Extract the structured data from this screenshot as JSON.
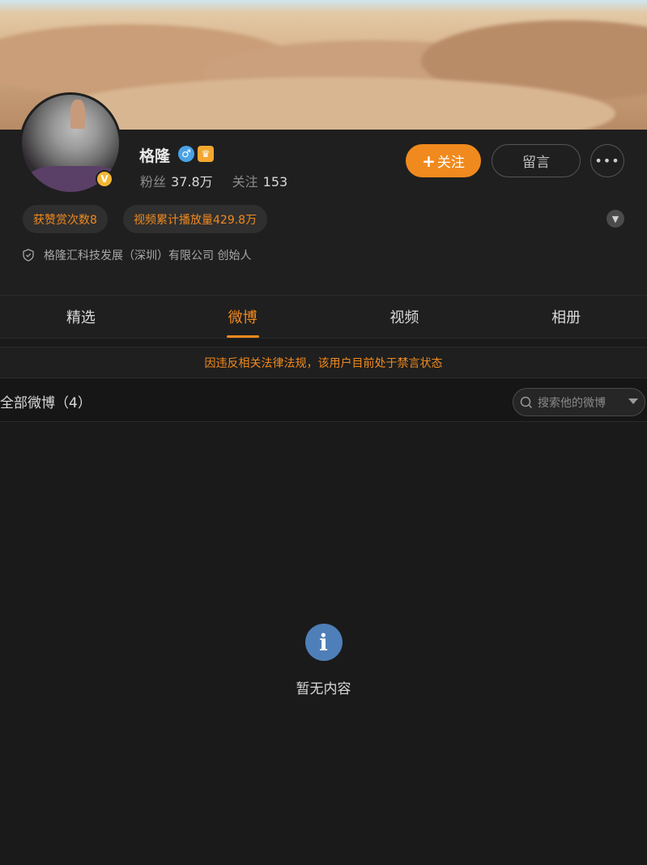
{
  "profile": {
    "name": "格隆",
    "verified_badge": "V",
    "gender_symbol": "♂",
    "fans_label": "粉丝",
    "fans_value": "37.8万",
    "following_label": "关注",
    "following_value": "153",
    "follow_button": "关注",
    "follow_plus": "+",
    "message_button": "留言",
    "more_button": "•••",
    "tags": [
      "获赞赏次数8",
      "视频累计播放量429.8万"
    ],
    "company": "格隆汇科技发展（深圳）有限公司 创始人"
  },
  "tabs": [
    {
      "label": "精选",
      "active": false
    },
    {
      "label": "微博",
      "active": true
    },
    {
      "label": "视频",
      "active": false
    },
    {
      "label": "相册",
      "active": false
    }
  ],
  "notice": "因违反相关法律法规，该用户目前处于禁言状态",
  "list": {
    "title": "全部微博（4）",
    "search_placeholder": "搜索他的微博"
  },
  "empty": {
    "icon_glyph": "i",
    "text": "暂无内容"
  },
  "colors": {
    "accent": "#f08a1e",
    "background": "#1a1a1a",
    "info_blue": "#4f7fb8",
    "gender_blue": "#4aa2e6",
    "verified_gold": "#f3b734"
  }
}
